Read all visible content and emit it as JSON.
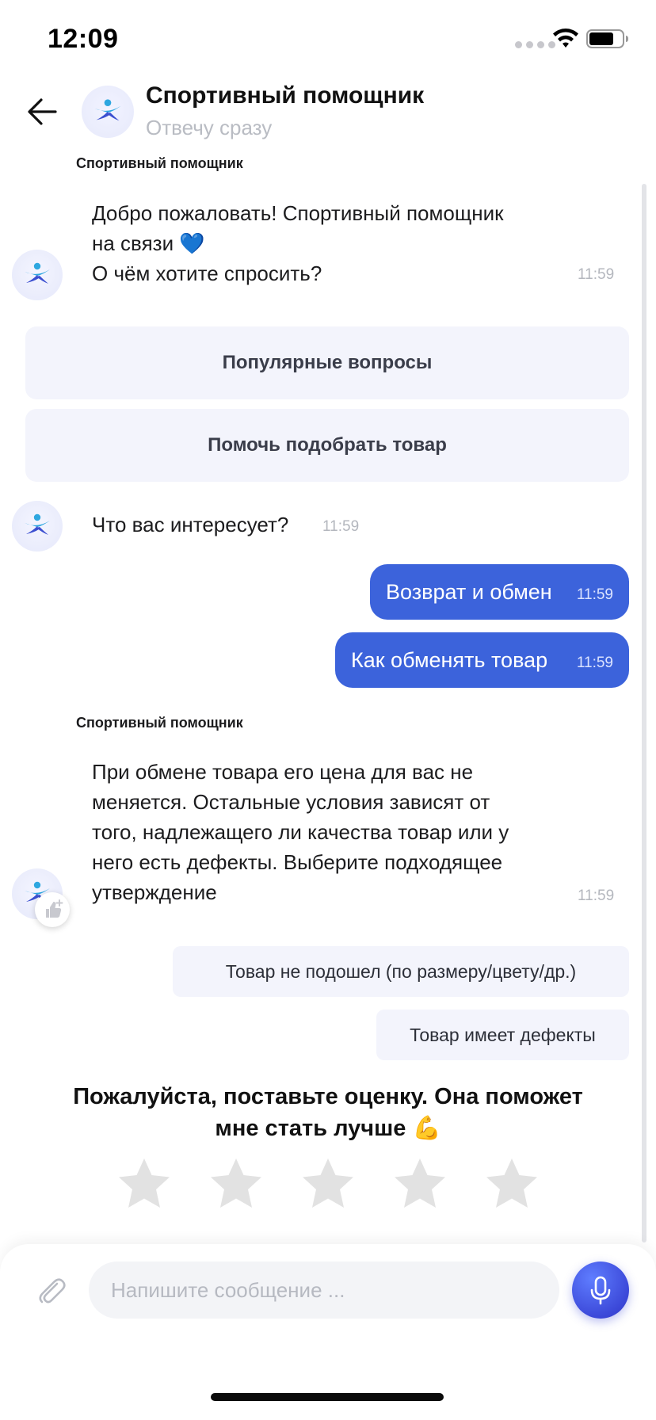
{
  "status_bar": {
    "time": "12:09"
  },
  "header": {
    "title": "Спортивный помощник",
    "subtitle": "Отвечу сразу"
  },
  "chat": {
    "welcome": {
      "sender": "Спортивный помощник",
      "lines": [
        "Добро пожаловать! Спортивный помощник",
        "на связи",
        "О чём хотите спросить?"
      ],
      "heart_emoji": "💙",
      "time": "11:59"
    },
    "menu_options": [
      "Популярные вопросы",
      "Помочь подобрать товар"
    ],
    "question": {
      "text": "Что вас интересует?",
      "time": "11:59"
    },
    "user_messages": [
      {
        "text": "Возврат и обмен",
        "time": "11:59"
      },
      {
        "text": "Как обменять товар",
        "time": "11:59"
      }
    ],
    "answer": {
      "sender": "Спортивный помощник",
      "lines": [
        "При обмене товара его цена для вас не",
        "меняется. Остальные условия зависят от",
        "того, надлежащего ли качества товар или у",
        "него есть дефекты. Выберите подходящее",
        "утверждение"
      ],
      "time": "11:59"
    },
    "reply_options": [
      "Товар не подошел (по размеру/цвету/др.)",
      "Товар имеет дефекты"
    ]
  },
  "rating": {
    "title_line1": "Пожалуйста, поставьте оценку. Она поможет",
    "title_line2": "мне стать лучше",
    "emoji": "💪",
    "stars_total": 5,
    "stars_selected": 0
  },
  "composer": {
    "placeholder": "Напишите сообщение ..."
  },
  "colors": {
    "accent": "#3c63db",
    "choice_bg": "#f3f4fc",
    "star": "#e2e2e2",
    "mic": "#3c49d9"
  }
}
